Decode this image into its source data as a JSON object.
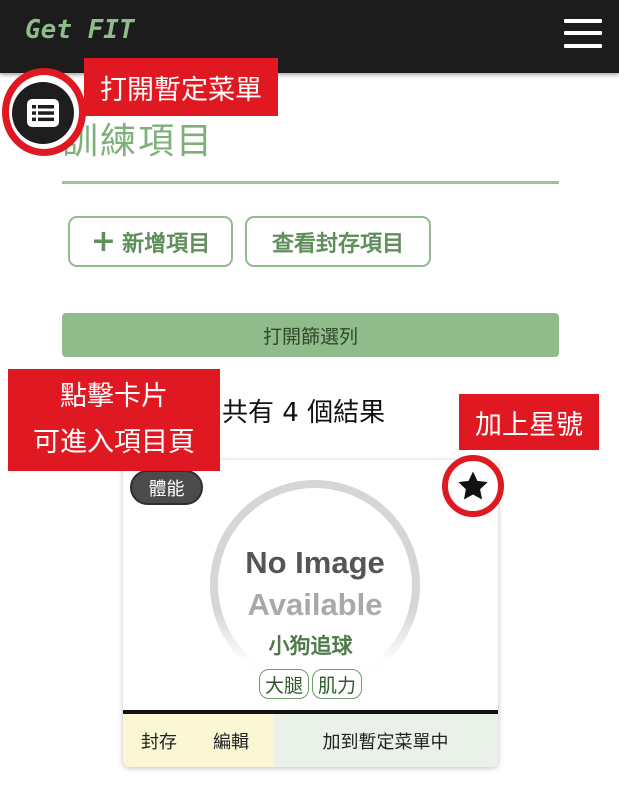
{
  "navbar": {
    "brand": "Get FIT",
    "menu_icon": "hamburger-icon"
  },
  "page": {
    "title": "訓練項目"
  },
  "actions": {
    "add_label": "新增項目",
    "add_icon": "plus-icon",
    "archive_label": "查看封存項目"
  },
  "filter": {
    "label": "打開篩選列"
  },
  "results": {
    "summary": "共有 4 個結果"
  },
  "card": {
    "category": "體能",
    "placeholder_line1": "No Image",
    "placeholder_line2": "Available",
    "name": "小狗追球",
    "tags": [
      "大腿",
      "肌力"
    ],
    "archive_label": "封存",
    "edit_label": "編輯",
    "add_temp_label": "加到暫定菜單中",
    "star_icon": "star-icon"
  },
  "menu_button": {
    "icon": "list-icon"
  },
  "annotations": {
    "menu": "打開暫定菜單",
    "card_line1": "點擊卡片",
    "card_line2": "可進入項目頁",
    "star": "加上星號"
  },
  "colors": {
    "accent_green": "#8fbc8a",
    "annotation_red": "#e01822",
    "navbar": "#1c1c1c"
  }
}
